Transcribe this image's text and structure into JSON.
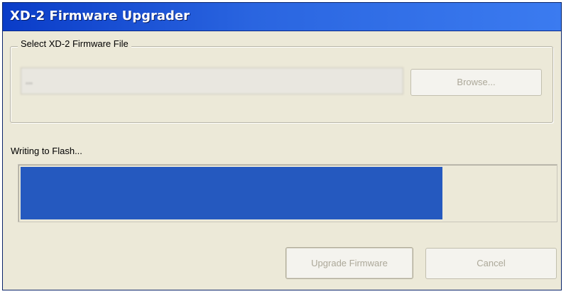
{
  "window": {
    "title": "XD-2 Firmware Upgrader"
  },
  "file_group": {
    "label": "Select XD-2 Firmware File",
    "file_path": "...",
    "browse_label": "Browse..."
  },
  "progress": {
    "status": "Writing to Flash...",
    "percent": 79,
    "fill_color": "#2559bf"
  },
  "buttons": {
    "upgrade_label": "Upgrade Firmware",
    "cancel_label": "Cancel"
  },
  "colors": {
    "titlebar": "#2a65e0",
    "window_bg": "#ece9d8",
    "disabled_text": "#aca899"
  }
}
